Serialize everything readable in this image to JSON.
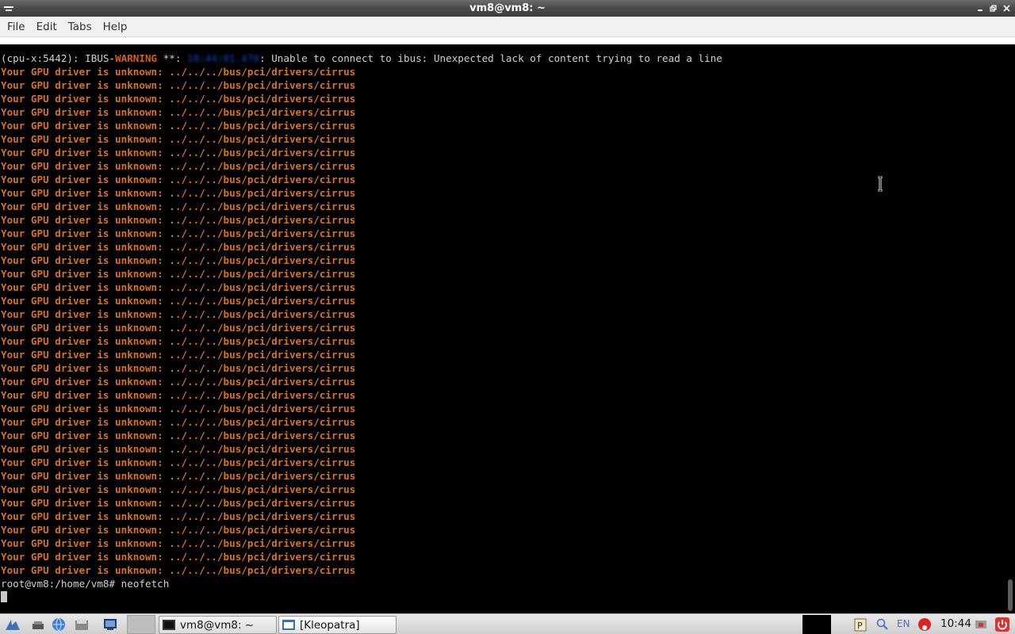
{
  "window": {
    "title": "vm8@vm8: ~"
  },
  "menu": [
    "File",
    "Edit",
    "Tabs",
    "Help"
  ],
  "terminal": {
    "warning_prefix": "(cpu-x:5442): IBUS-",
    "warning_word": "WARNING",
    "warning_mid": " **: ",
    "warning_time": "10:44:01.470",
    "warning_msg": ": Unable to connect to ibus: Unexpected lack of content trying to read a line",
    "gpu_line": "Your GPU driver is unknown: ../../../bus/pci/drivers/cirrus",
    "gpu_line_count": 38,
    "prompt": "root@vm8:/home/vm8# ",
    "command": "neofetch"
  },
  "taskbar": {
    "tasks": [
      {
        "label": "vm8@vm8: ~"
      },
      {
        "label": "[Kleopatra]"
      }
    ],
    "lang": "EN",
    "clock": "10:44"
  },
  "colors": {
    "warning": "#d75f00",
    "gpu_text": "#d7731f",
    "terminal_bg": "#000000"
  },
  "icons": {
    "title_left": "window-menu-icon",
    "minimize": "minimize-icon",
    "maximize": "maximize-icon",
    "close": "close-icon"
  }
}
